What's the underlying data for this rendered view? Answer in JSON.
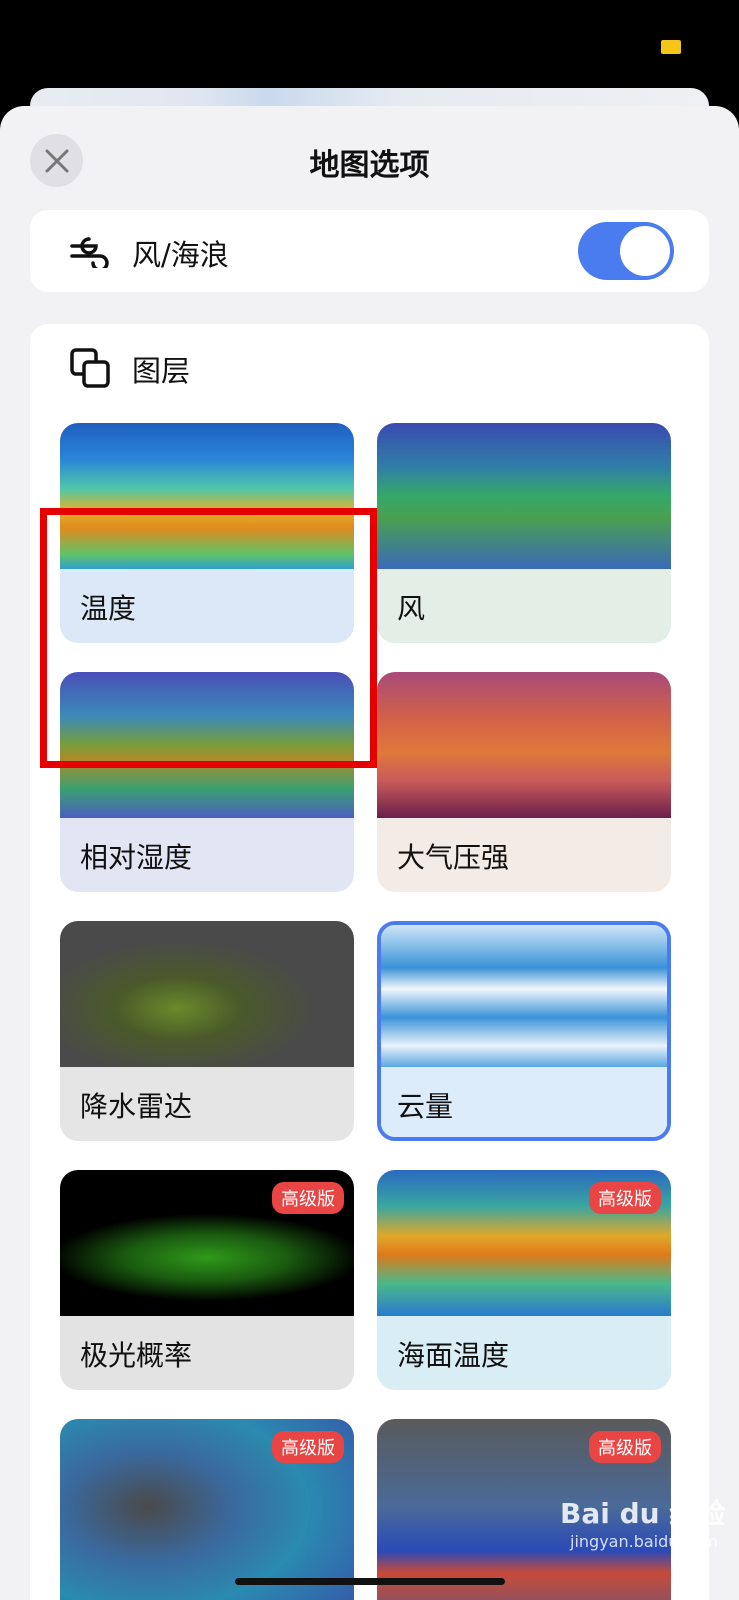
{
  "title": "地图选项",
  "wind_waves": {
    "label": "风/海浪",
    "enabled": true
  },
  "layers": {
    "title": "图层",
    "items": [
      {
        "label": "温度",
        "premium": false,
        "selected": false
      },
      {
        "label": "风",
        "premium": false,
        "selected": false
      },
      {
        "label": "相对湿度",
        "premium": false,
        "selected": false
      },
      {
        "label": "大气压强",
        "premium": false,
        "selected": false
      },
      {
        "label": "降水雷达",
        "premium": false,
        "selected": false
      },
      {
        "label": "云量",
        "premium": false,
        "selected": true
      },
      {
        "label": "极光概率",
        "premium": true,
        "selected": false
      },
      {
        "label": "海面温度",
        "premium": true,
        "selected": false
      },
      {
        "label": "",
        "premium": true,
        "selected": false
      },
      {
        "label": "",
        "premium": true,
        "selected": false
      }
    ],
    "premium_badge": "高级版"
  },
  "watermark": {
    "brand": "Bai du 经验",
    "site": "jingyan.baidu.com"
  },
  "colors": {
    "accent": "#4a7cf0",
    "highlight": "#e60000",
    "badge": "#e94545"
  }
}
